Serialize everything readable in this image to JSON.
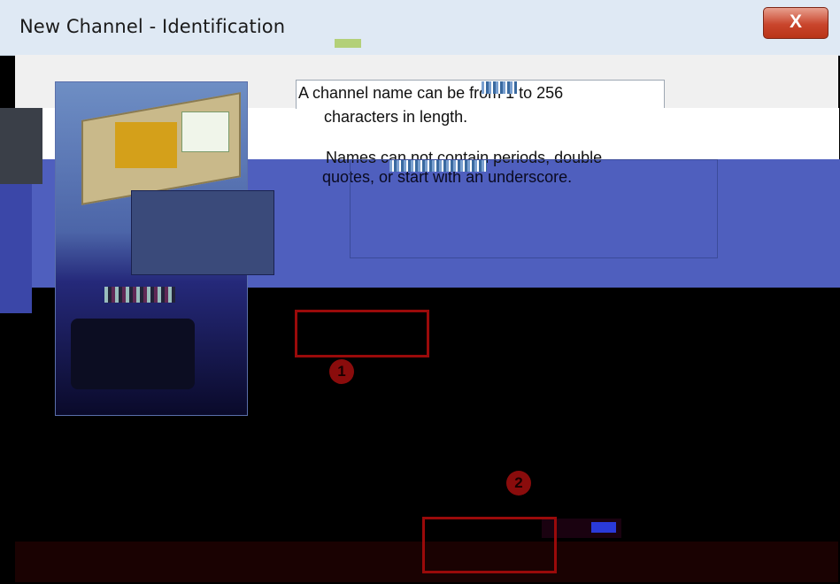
{
  "window": {
    "title": "New Channel - Identification",
    "close_glyph": "X"
  },
  "help": {
    "line1": "A channel name can be from 1 to 256",
    "line2": "characters in length.",
    "line3": "Names can not contain periods, double",
    "line4": "quotes, or start with an underscore."
  },
  "annotations": {
    "marker1": "1",
    "marker2": "2"
  },
  "icons": {
    "wizard_image": "computer-network-illustration-icon",
    "close": "close-icon"
  },
  "colors": {
    "annotation_red": "#9a0a0a",
    "titlebar": "#dfe9f4",
    "close_red": "#c9452c"
  }
}
